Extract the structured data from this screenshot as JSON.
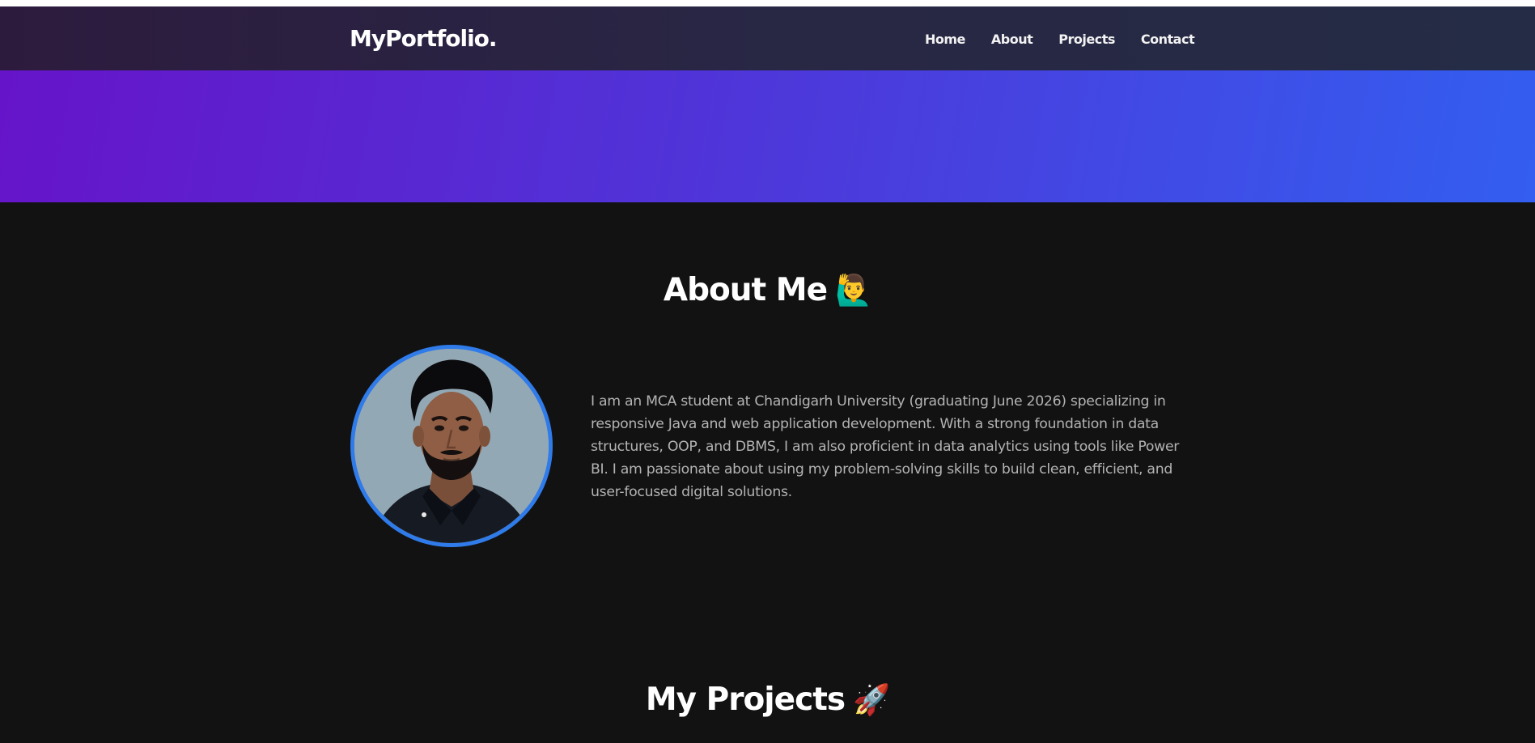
{
  "navbar": {
    "logo": "MyPortfolio.",
    "links": [
      "Home",
      "About",
      "Projects",
      "Contact"
    ]
  },
  "about": {
    "title": "About Me",
    "emoji": "🙋‍♂️",
    "paragraph": "I am an MCA student at Chandigarh University (graduating June 2026) specializing in responsive Java and web application development. With a strong foundation in data structures, OOP, and DBMS, I am also proficient in data analytics using tools like Power BI. I am passionate about using my problem-solving skills to build clean, efficient, and user-focused digital solutions."
  },
  "projects": {
    "title": "My Projects",
    "emoji": "🚀"
  },
  "colors": {
    "navbar_bg": "#282744",
    "hero_gradient_start": "#6614c9",
    "hero_gradient_end": "#335ef0",
    "page_bg": "#121212",
    "avatar_border": "#2f7bea",
    "body_text": "#b3b3b3"
  }
}
